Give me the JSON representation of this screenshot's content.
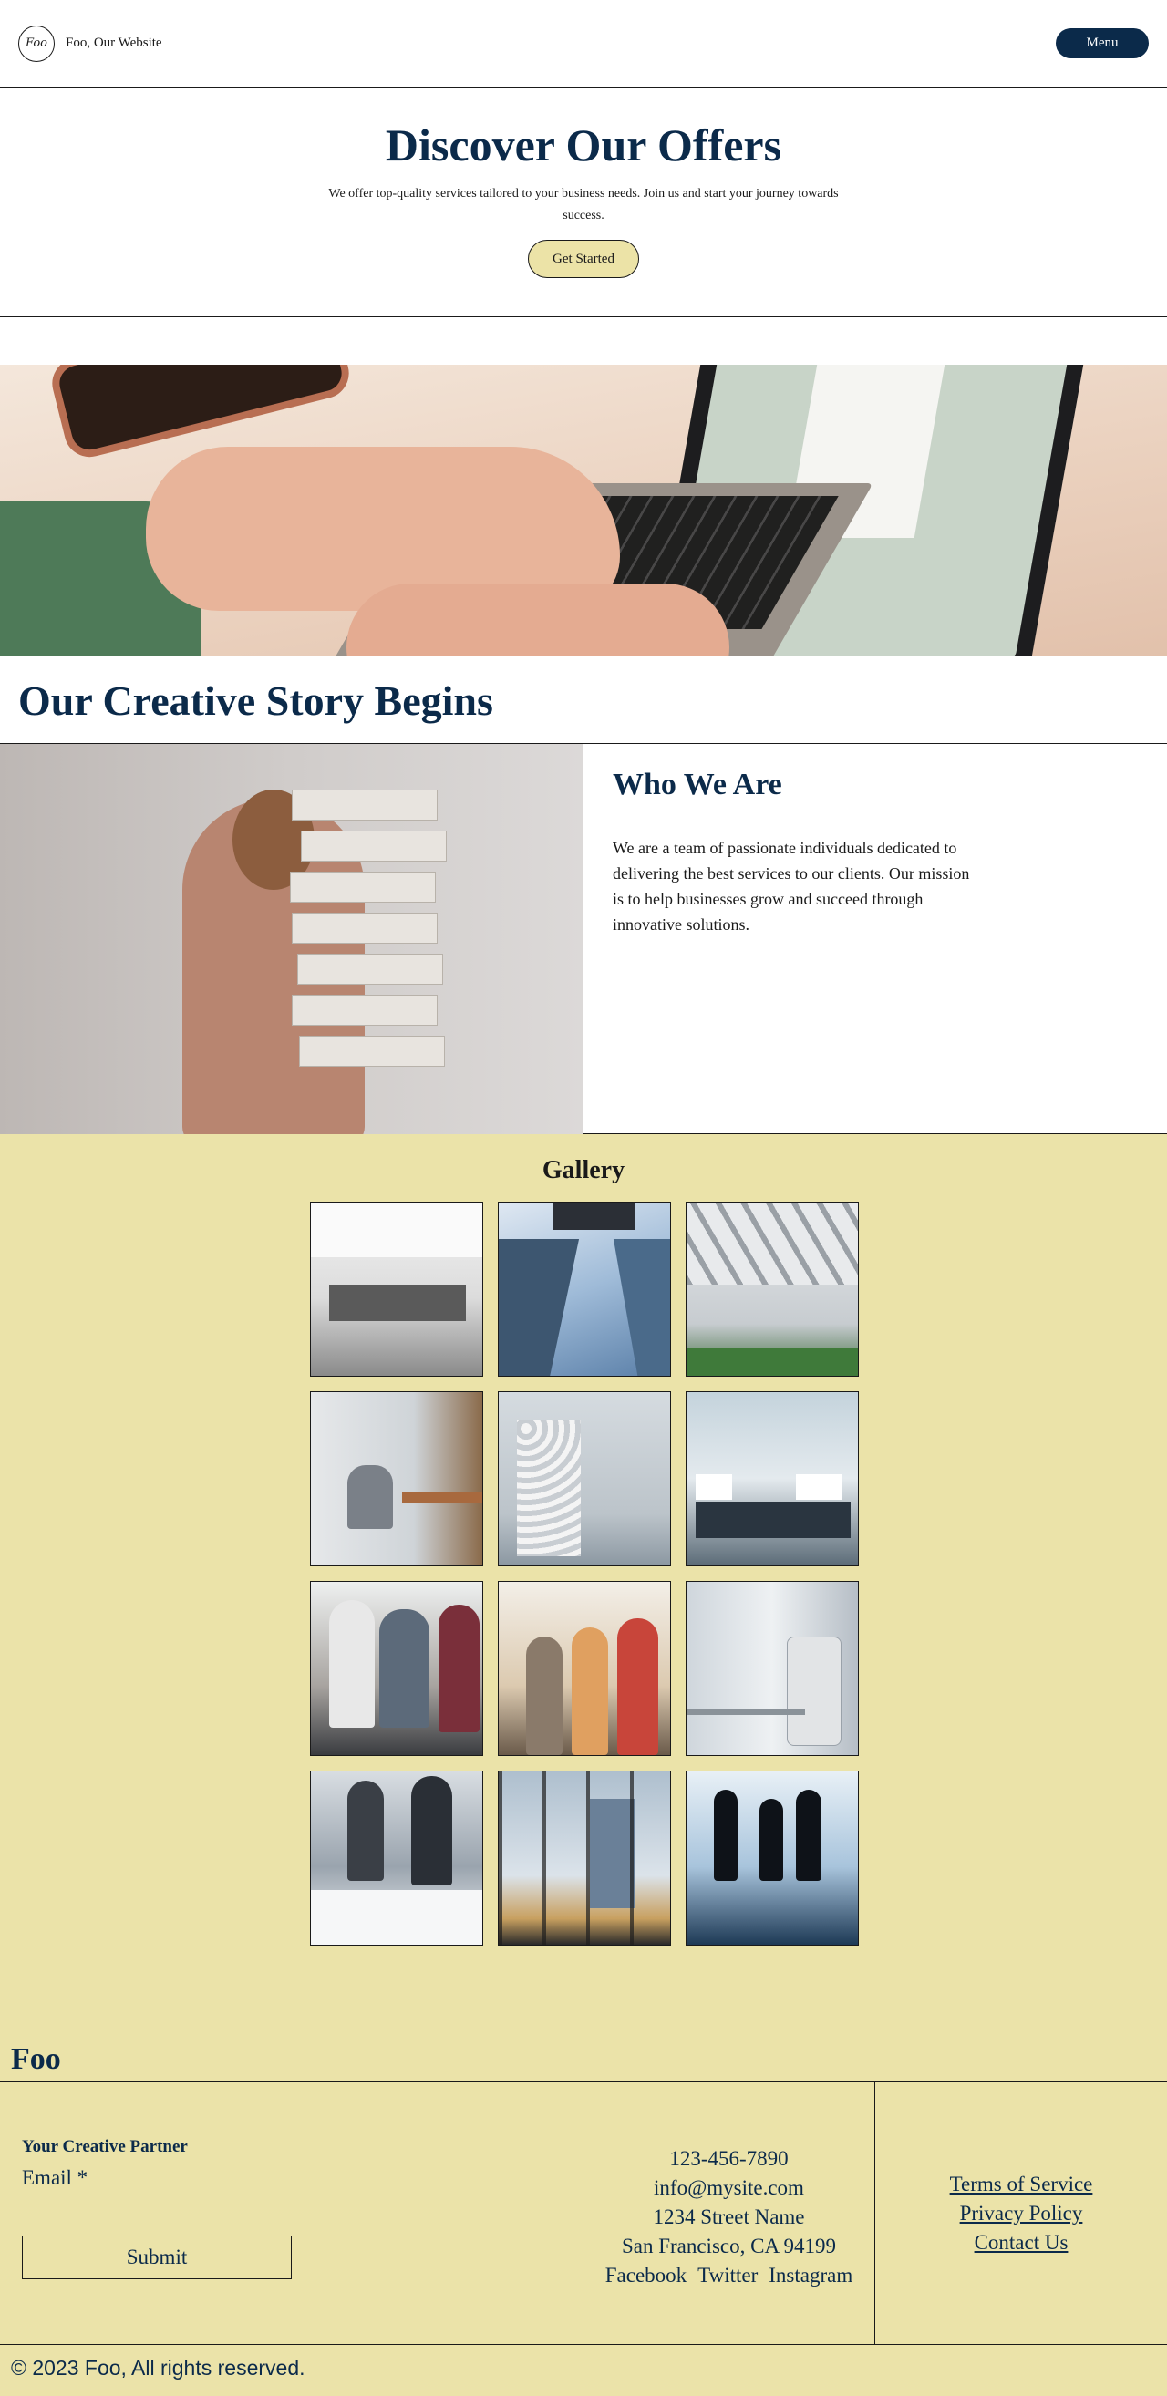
{
  "header": {
    "logo_text": "Foo",
    "site_name": "Foo, Our Website",
    "menu_label": "Menu"
  },
  "hero": {
    "title": "Discover Our Offers",
    "description": "We offer top-quality services tailored to your business needs. Join us and start your journey towards success.",
    "cta_label": "Get Started"
  },
  "story": {
    "title": "Our Creative Story Begins"
  },
  "about": {
    "heading": "Who We Are",
    "body": "We are a team of passionate individuals dedicated to delivering the best services to our clients. Our mission is to help businesses grow and succeed through innovative solutions."
  },
  "gallery": {
    "title": "Gallery",
    "tiles": 12
  },
  "footer": {
    "brand": "Foo",
    "tagline": "Your Creative Partner",
    "email_label": "Email *",
    "email_value": "",
    "submit_label": "Submit",
    "phone": "123-456-7890",
    "email": "info@mysite.com",
    "address_line1": "1234 Street Name",
    "address_line2": "San Francisco, CA 94199",
    "socials": [
      "Facebook",
      "Twitter",
      "Instagram"
    ],
    "links": [
      "Terms of Service",
      "Privacy Policy",
      "Contact Us"
    ],
    "copyright": "© 2023 Foo, All rights reserved."
  },
  "colors": {
    "navy": "#0b2a4a",
    "cream": "#ebe3a9",
    "button_cream": "#ece3a7"
  }
}
